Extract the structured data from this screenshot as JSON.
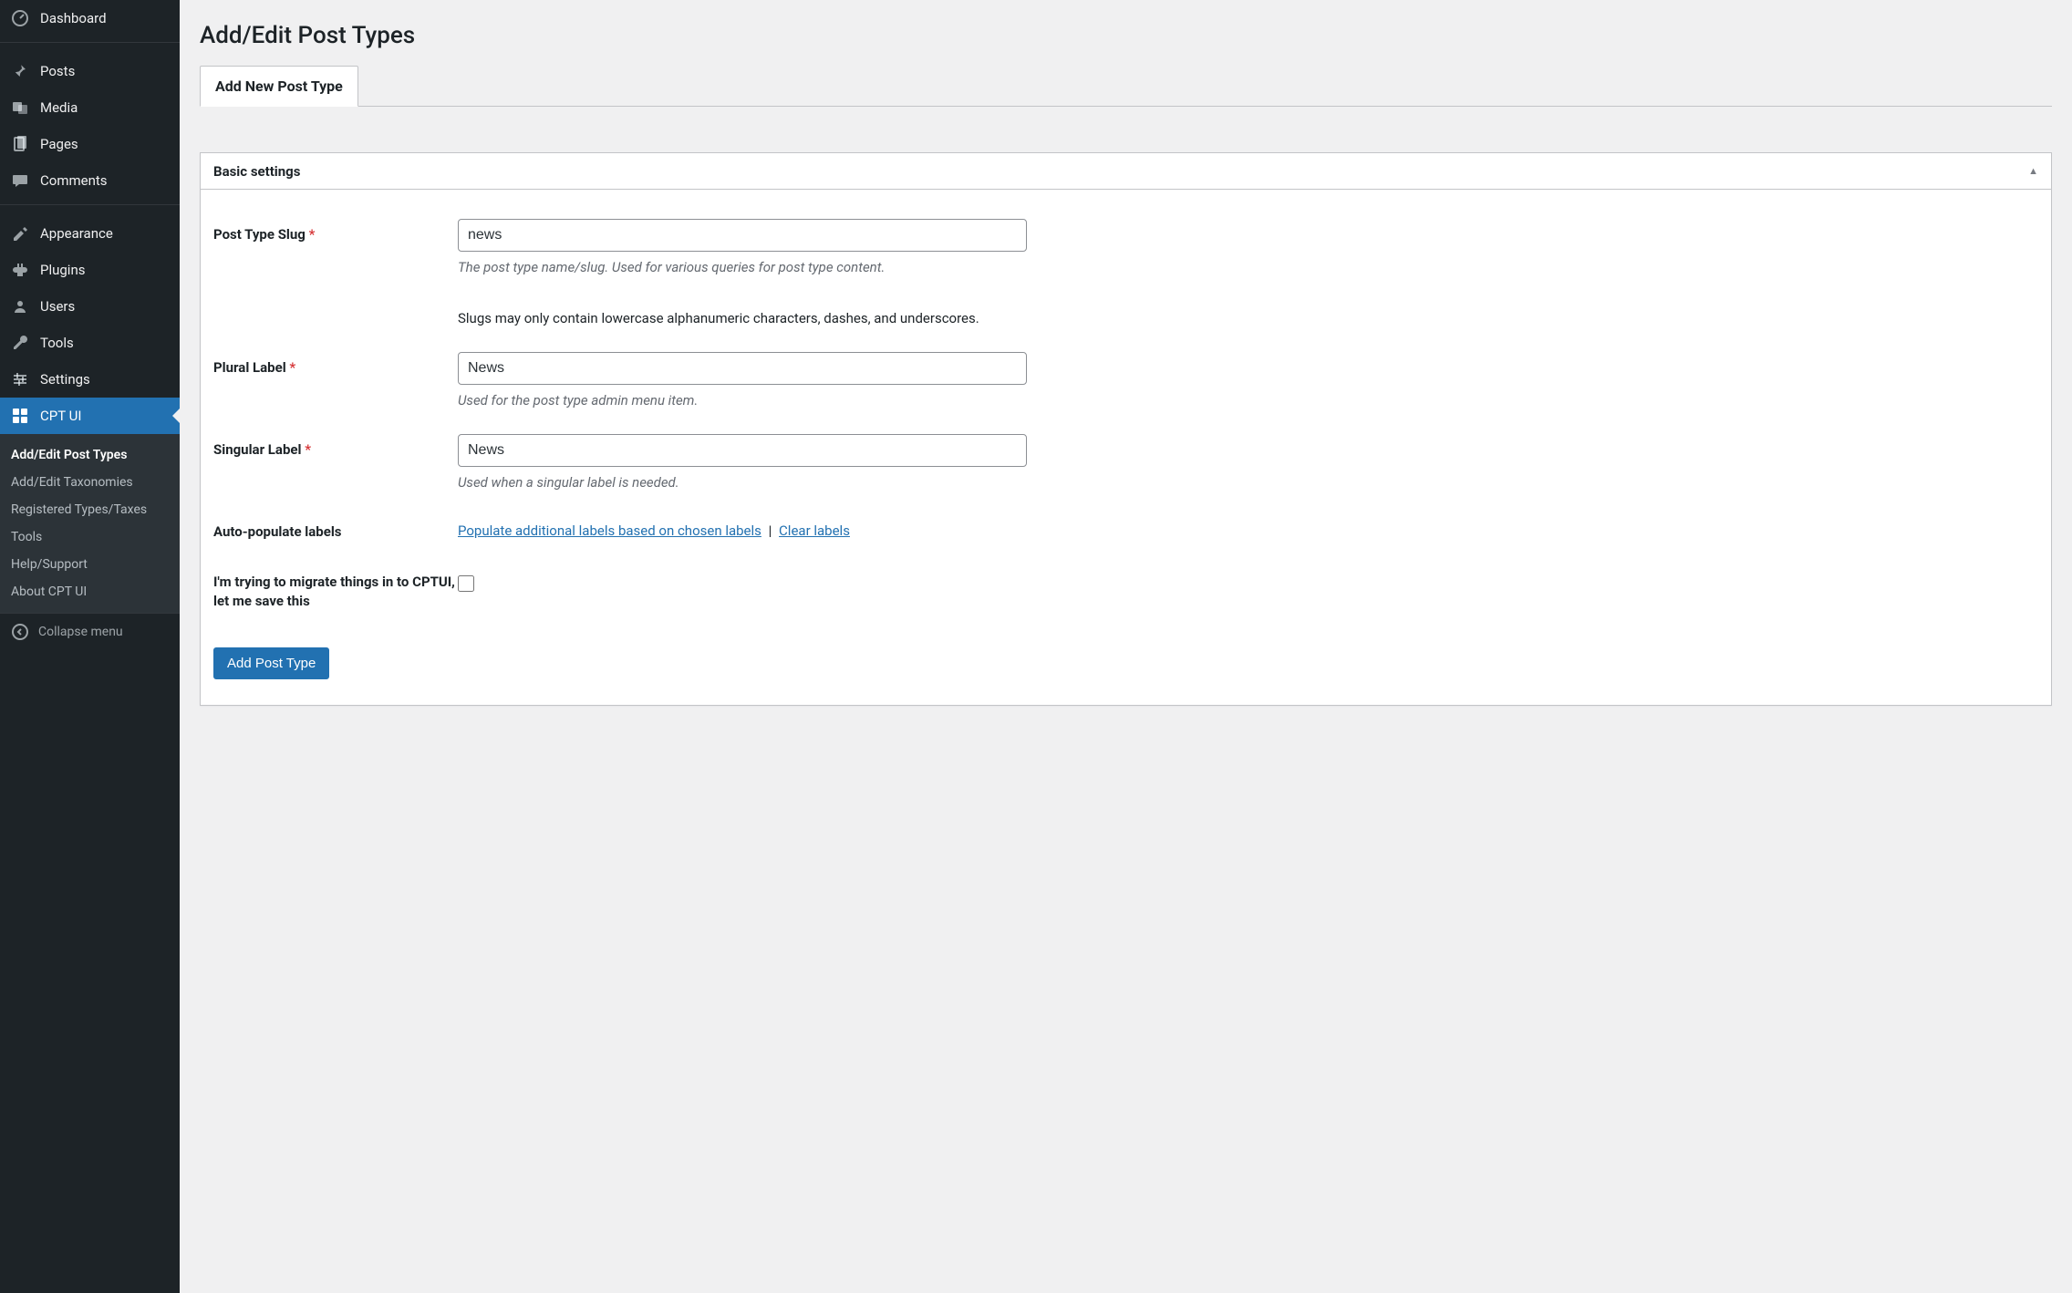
{
  "sidebar": {
    "items": [
      {
        "label": "Dashboard",
        "icon": "dashboard"
      },
      {
        "label": "Posts",
        "icon": "pin"
      },
      {
        "label": "Media",
        "icon": "media"
      },
      {
        "label": "Pages",
        "icon": "pages"
      },
      {
        "label": "Comments",
        "icon": "comments"
      },
      {
        "label": "Appearance",
        "icon": "appearance"
      },
      {
        "label": "Plugins",
        "icon": "plugins"
      },
      {
        "label": "Users",
        "icon": "users"
      },
      {
        "label": "Tools",
        "icon": "tools"
      },
      {
        "label": "Settings",
        "icon": "settings"
      },
      {
        "label": "CPT UI",
        "icon": "cptui"
      }
    ],
    "submenu": [
      "Add/Edit Post Types",
      "Add/Edit Taxonomies",
      "Registered Types/Taxes",
      "Tools",
      "Help/Support",
      "About CPT UI"
    ],
    "collapse": "Collapse menu"
  },
  "page": {
    "title": "Add/Edit Post Types",
    "active_tab": "Add New Post Type"
  },
  "panel": {
    "title": "Basic settings"
  },
  "form": {
    "slug": {
      "label": "Post Type Slug",
      "required": "*",
      "value": "news",
      "desc": "The post type name/slug. Used for various queries for post type content.",
      "note": "Slugs may only contain lowercase alphanumeric characters, dashes, and underscores."
    },
    "plural": {
      "label": "Plural Label",
      "required": "*",
      "value": "News",
      "desc": "Used for the post type admin menu item."
    },
    "singular": {
      "label": "Singular Label",
      "required": "*",
      "value": "News",
      "desc": "Used when a singular label is needed."
    },
    "autopopulate": {
      "label": "Auto-populate labels",
      "link1": "Populate additional labels based on chosen labels",
      "sep": "|",
      "link2": "Clear labels"
    },
    "migrate": {
      "label": "I'm trying to migrate things in to CPTUI, let me save this"
    },
    "submit": "Add Post Type"
  }
}
